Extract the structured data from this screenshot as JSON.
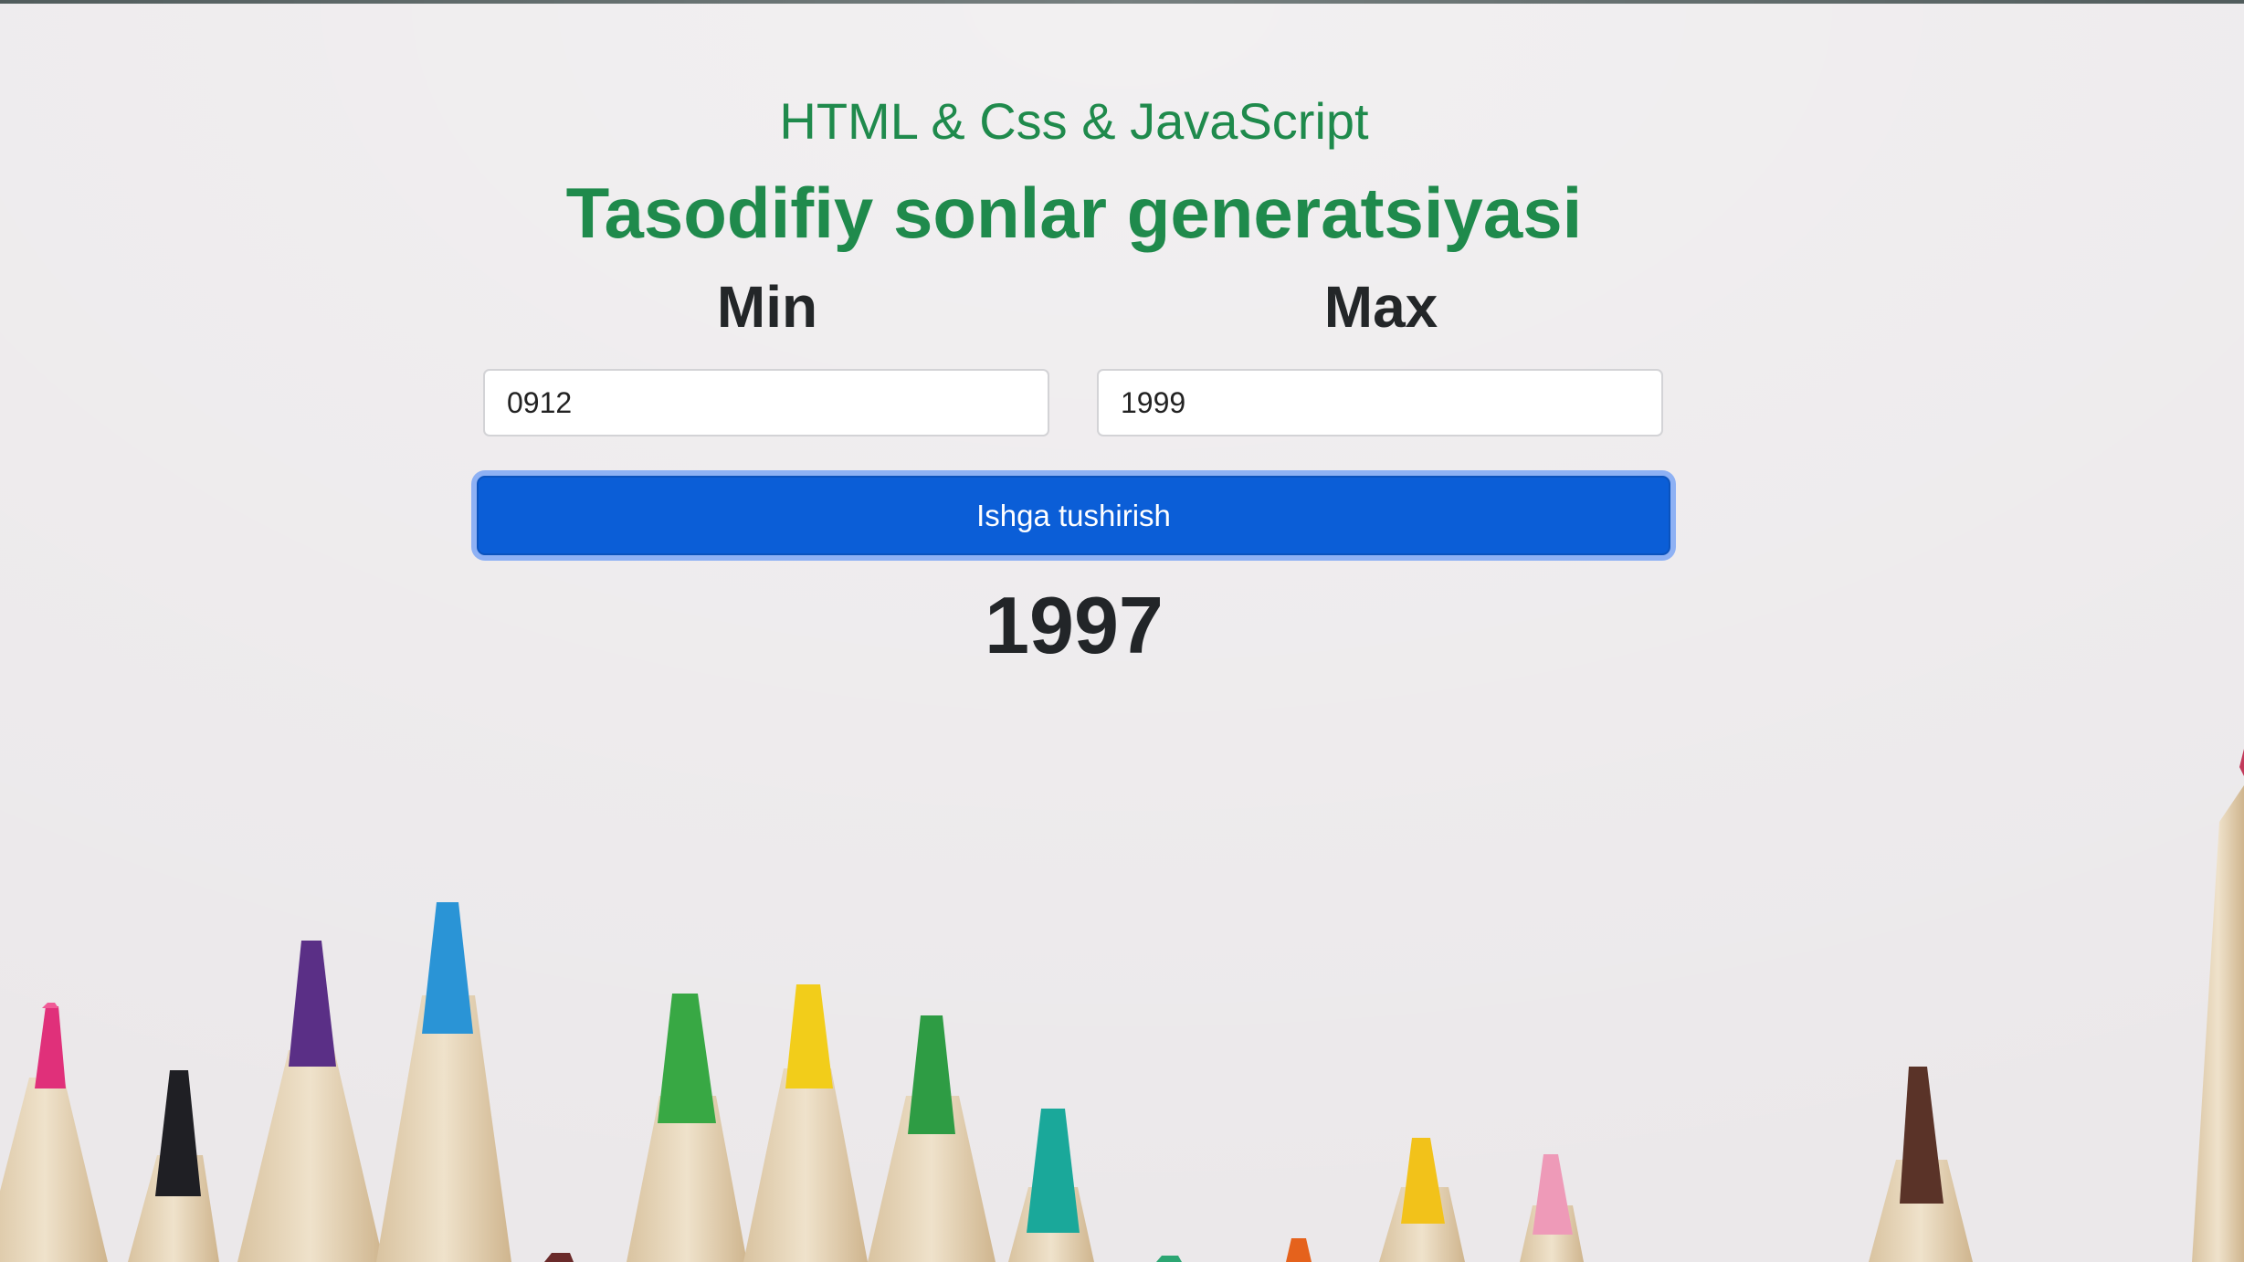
{
  "header": {
    "subtitle": "HTML & Css & JavaScript",
    "title": "Tasodifiy sonlar generatsiyasi"
  },
  "form": {
    "min_label": "Min",
    "max_label": "Max",
    "min_value": "0912",
    "max_value": "1999",
    "run_label": "Ishga tushirish"
  },
  "result": {
    "value": "1997"
  },
  "colors": {
    "heading_green": "#1f8a4c",
    "button_blue": "#0b5ed7",
    "background": "#ebe8ea"
  },
  "background_image": {
    "subject": "colored-pencils",
    "pencil_colors": [
      "#e0307a",
      "#1f1f24",
      "#5a2f86",
      "#2a94d6",
      "#38a844",
      "#f2cd1a",
      "#2e9c44",
      "#1aa89a",
      "#2ca673",
      "#e5621c",
      "#f2c21a",
      "#ee9ab8",
      "#5a3328"
    ]
  }
}
